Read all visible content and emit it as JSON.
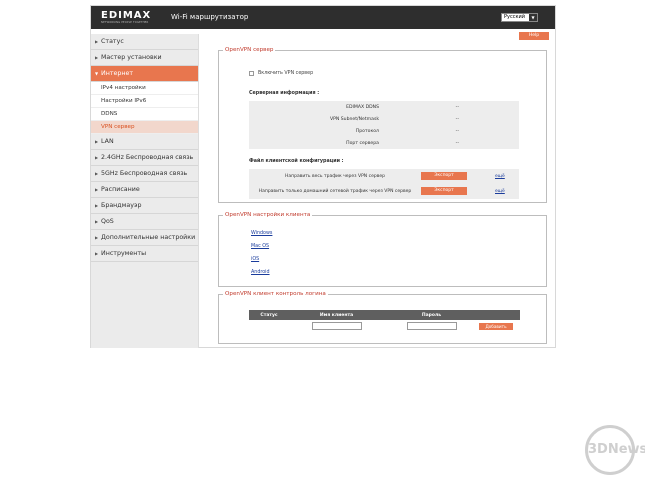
{
  "header": {
    "logo_text": "EDIMAX",
    "logo_tagline": "NETWORKING PEOPLE TOGETHER",
    "app_title": "Wi-Fi маршрутизатор",
    "language": "Русский"
  },
  "help_label": "Help",
  "sidebar": {
    "items": [
      {
        "label": "Статус"
      },
      {
        "label": "Мастер установки"
      },
      {
        "label": "Интернет"
      },
      {
        "label": "LAN"
      },
      {
        "label": "2.4GHz Беспроводная связь"
      },
      {
        "label": "5GHz Беспроводная связь"
      },
      {
        "label": "Расписание"
      },
      {
        "label": "Брандмауэр"
      },
      {
        "label": "QoS"
      },
      {
        "label": "Дополнительные настройки"
      },
      {
        "label": "Инструменты"
      }
    ],
    "internet_sub": [
      {
        "label": "IPv4 настройки"
      },
      {
        "label": "Настройки IPv6"
      },
      {
        "label": "DDNS"
      },
      {
        "label": "VPN сервер"
      }
    ]
  },
  "vpn_server": {
    "legend": "OpenVPN сервер",
    "enable_label": "Включить VPN сервер",
    "server_info_title": "Серверная информация :",
    "info_rows": [
      {
        "key": "EDIMAX DDNS",
        "value": "--"
      },
      {
        "key": "VPN Subnet/Netmask",
        "value": "--"
      },
      {
        "key": "Протокол",
        "value": "--"
      },
      {
        "key": "Порт сервера",
        "value": "--"
      }
    ],
    "config_title": "Файл клиентской конфигурации :",
    "config_rows": [
      {
        "label": "Направить весь трафик через VPN сервер",
        "button": "Экспорт",
        "link": "ещё"
      },
      {
        "label": "Направить только домашний сетевой трафик через VPN сервер",
        "button": "Экспорт",
        "link": "ещё"
      }
    ]
  },
  "client_settings": {
    "legend": "OpenVPN настройки клиента",
    "links": [
      "Windows",
      "Mac OS",
      "iOS",
      "Android"
    ]
  },
  "login_control": {
    "legend": "OpenVPN клиент контроль логина",
    "columns": [
      "Статус",
      "Имя клиента",
      "Пароль"
    ],
    "add_button": "Добавить"
  },
  "watermark": "3DNews"
}
